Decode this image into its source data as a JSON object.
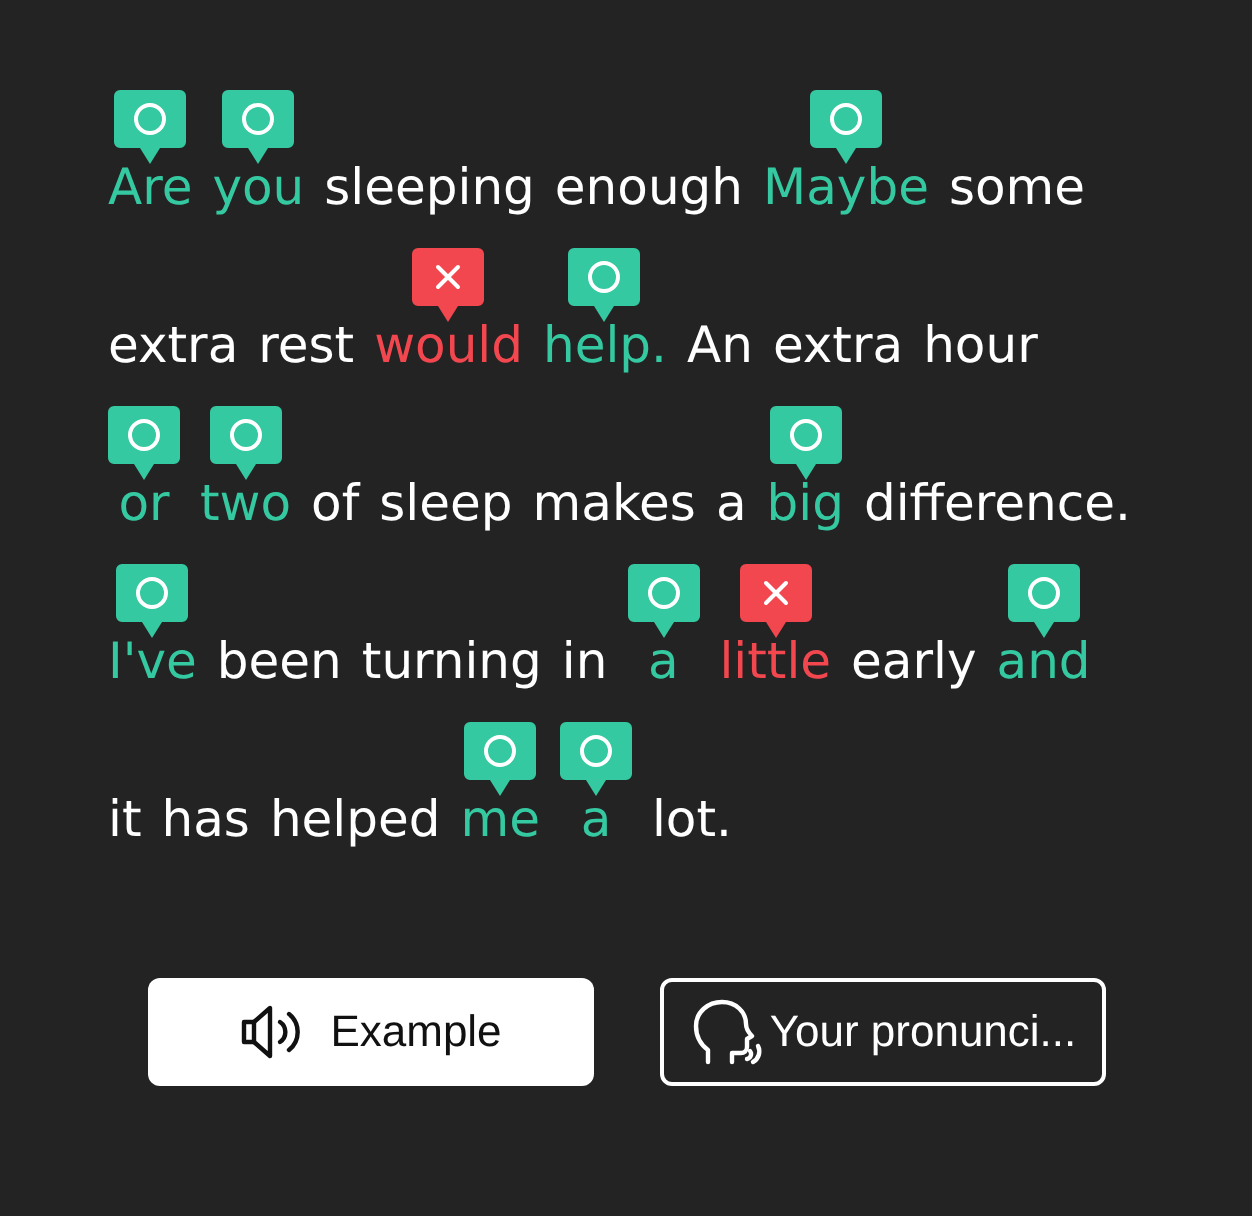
{
  "lines": [
    {
      "words": [
        {
          "text": "Are",
          "kind": "correct"
        },
        {
          "text": "you",
          "kind": "correct"
        },
        {
          "text": "sleeping",
          "kind": "plain"
        },
        {
          "text": "enough",
          "kind": "plain"
        },
        {
          "text": "Maybe",
          "kind": "correct"
        },
        {
          "text": "some",
          "kind": "plain"
        }
      ]
    },
    {
      "words": [
        {
          "text": "extra",
          "kind": "plain"
        },
        {
          "text": "rest",
          "kind": "plain"
        },
        {
          "text": "would",
          "kind": "wrong"
        },
        {
          "text": "help.",
          "kind": "correct"
        },
        {
          "text": "An",
          "kind": "plain"
        },
        {
          "text": "extra",
          "kind": "plain"
        },
        {
          "text": "hour",
          "kind": "plain"
        }
      ]
    },
    {
      "words": [
        {
          "text": "or",
          "kind": "correct"
        },
        {
          "text": "two",
          "kind": "correct"
        },
        {
          "text": "of",
          "kind": "plain"
        },
        {
          "text": "sleep",
          "kind": "plain"
        },
        {
          "text": "makes",
          "kind": "plain"
        },
        {
          "text": "a",
          "kind": "plain"
        },
        {
          "text": "big",
          "kind": "correct"
        },
        {
          "text": "difference.",
          "kind": "plain"
        }
      ]
    },
    {
      "words": [
        {
          "text": "I've",
          "kind": "correct"
        },
        {
          "text": "been",
          "kind": "plain"
        },
        {
          "text": "turning",
          "kind": "plain"
        },
        {
          "text": "in",
          "kind": "plain"
        },
        {
          "text": "a",
          "kind": "correct"
        },
        {
          "text": "little",
          "kind": "wrong"
        },
        {
          "text": "early",
          "kind": "plain"
        },
        {
          "text": "and",
          "kind": "correct"
        }
      ]
    },
    {
      "words": [
        {
          "text": "it",
          "kind": "plain"
        },
        {
          "text": "has",
          "kind": "plain"
        },
        {
          "text": "helped",
          "kind": "plain"
        },
        {
          "text": "me",
          "kind": "correct"
        },
        {
          "text": "a",
          "kind": "correct"
        },
        {
          "text": "lot.",
          "kind": "plain"
        }
      ]
    }
  ],
  "buttons": [
    {
      "kind": "example",
      "label": "Example"
    },
    {
      "kind": "recording",
      "label": "Your pronunci..."
    }
  ]
}
